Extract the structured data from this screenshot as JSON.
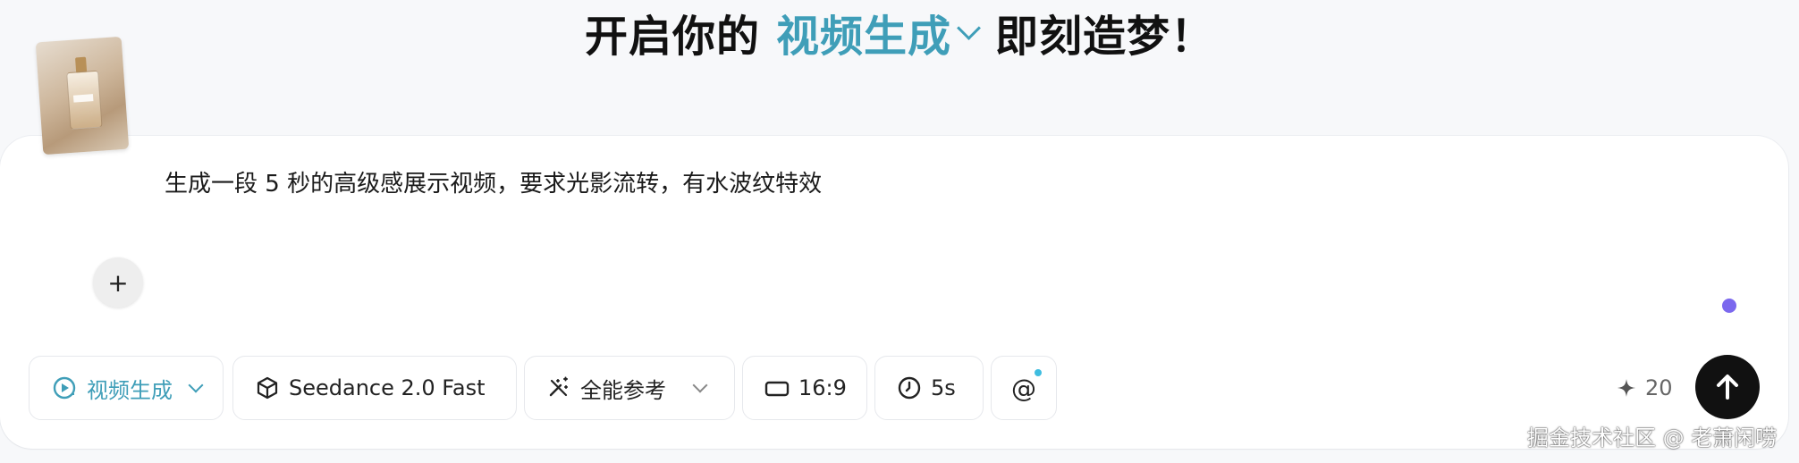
{
  "header": {
    "prefix": "开启你的",
    "mode": "视频生成",
    "suffix": "即刻造梦！"
  },
  "composer": {
    "prompt": "生成一段 5 秒的高级感展示视频，要求光影流转，有水波纹特效",
    "add_reference_label": "+"
  },
  "toolbar": {
    "mode": "视频生成",
    "model": "Seedance 2.0 Fast",
    "reference": "全能参考",
    "ratio": "16:9",
    "duration": "5s",
    "mention": "@",
    "credits": "20"
  },
  "watermark": "掘金技术社区 @ 老萧闲唠",
  "colors": {
    "accent": "#3f9eb8",
    "send": "#111111",
    "status_dot": "#7b68ee"
  }
}
